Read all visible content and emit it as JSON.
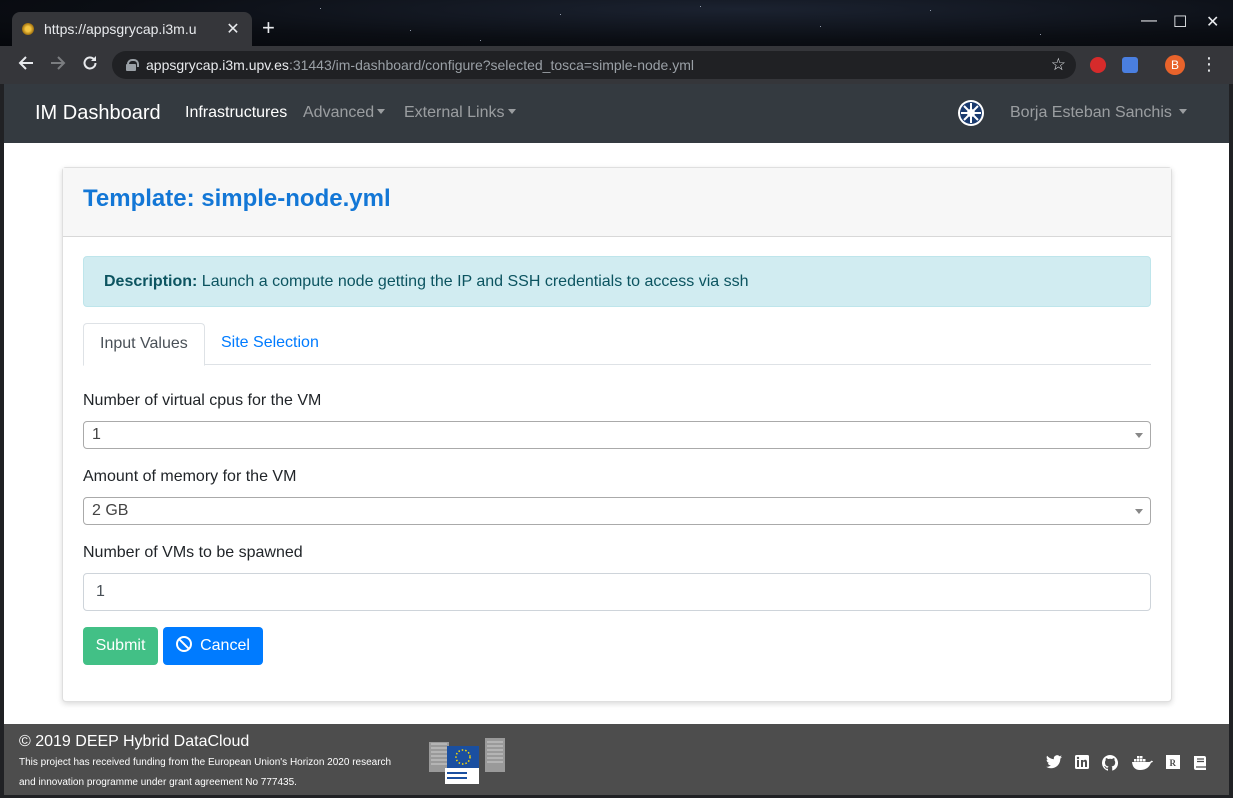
{
  "browser": {
    "tab_title": "https://appsgrycap.i3m.u",
    "url_host": "appsgrycap.i3m.upv.es",
    "url_rest": ":31443/im-dashboard/configure?selected_tosca=simple-node.yml",
    "profile_initial": "B",
    "new_tab_glyph": "+",
    "close_tab_glyph": "✕",
    "minimize_glyph": "—",
    "maximize_glyph": "☐",
    "close_window_glyph": "✕"
  },
  "navbar": {
    "brand": "IM Dashboard",
    "links": [
      "Infrastructures",
      "Advanced",
      "External Links"
    ],
    "user": "Borja Esteban Sanchis"
  },
  "card": {
    "title": "Template: simple-node.yml",
    "description_label": "Description:",
    "description_text": " Launch a compute node getting the IP and SSH credentials to access via ssh",
    "tabs": [
      "Input Values",
      "Site Selection"
    ],
    "fields": [
      {
        "label": "Number of virtual cpus for the VM",
        "value": "1",
        "type": "select"
      },
      {
        "label": "Amount of memory for the VM",
        "value": "2 GB",
        "type": "select"
      },
      {
        "label": "Number of VMs to be spawned",
        "value": "1",
        "type": "input"
      }
    ],
    "submit_label": "Submit",
    "cancel_label": "Cancel"
  },
  "footer": {
    "title": "© 2019 DEEP Hybrid DataCloud",
    "text": "This project has received funding from the European Union's Horizon 2020 research and innovation programme under grant agreement No 777435.",
    "eu_logo_text": "European Commission",
    "social_icons": [
      "twitter-icon",
      "linkedin-icon",
      "github-icon",
      "docker-icon",
      "r-icon",
      "book-icon"
    ]
  },
  "colors": {
    "brand_blue": "#1377d6",
    "submit_green": "#42c086",
    "cancel_blue": "#007bff",
    "navbar_bg": "#343a40",
    "footer_bg": "#4d4d4d",
    "alert_bg": "#d1ecf1"
  }
}
